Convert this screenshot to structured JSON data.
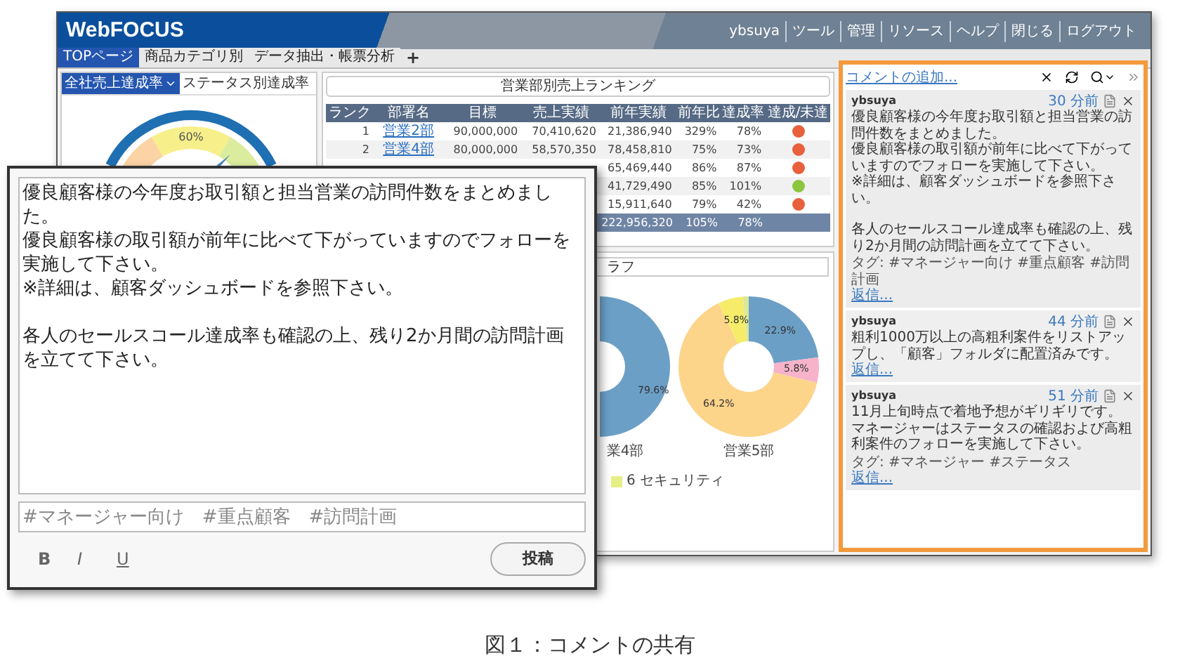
{
  "header": {
    "logo": "WebFOCUS",
    "links": [
      "ybsuya",
      "ツール",
      "管理",
      "リソース",
      "ヘルプ",
      "閉じる",
      "ログアウト"
    ]
  },
  "tabs": [
    {
      "label": "TOPページ",
      "selected": true
    },
    {
      "label": "商品カテゴリ別",
      "selected": false
    },
    {
      "label": "データ抽出・帳票分析",
      "selected": false
    }
  ],
  "add_tab": "+",
  "left_panel": {
    "tabs": [
      {
        "label": "全社売上達成率",
        "selected": true,
        "kind": "dropdown"
      },
      {
        "label": "ステータス別達成率",
        "selected": false,
        "kind": "plain"
      }
    ],
    "gauge_label": "60%"
  },
  "ranking": {
    "title": "営業部別売上ランキング",
    "columns": [
      "ランク",
      "部署名",
      "目標",
      "売上実績",
      "前年実績",
      "前年比",
      "達成率",
      "達成/未達"
    ],
    "rows": [
      {
        "rank": "1",
        "dept": "営業2部",
        "target": "90,000,000",
        "sales": "70,410,620",
        "prev": "21,386,940",
        "ratio": "329%",
        "rate": "78%",
        "color": "#e8603c"
      },
      {
        "rank": "2",
        "dept": "営業4部",
        "target": "80,000,000",
        "sales": "58,570,350",
        "prev": "78,458,810",
        "ratio": "75%",
        "rate": "73%",
        "color": "#e8603c"
      },
      {
        "prev": "65,469,440",
        "ratio": "86%",
        "rate": "87%",
        "color": "#e8603c"
      },
      {
        "prev": "41,729,490",
        "ratio": "85%",
        "rate": "101%",
        "color": "#8cc63f"
      },
      {
        "prev": "15,911,640",
        "ratio": "79%",
        "rate": "42%",
        "color": "#e8603c"
      }
    ],
    "total": {
      "prev": "222,956,320",
      "ratio": "105%",
      "rate": "78%"
    }
  },
  "graph": {
    "title": "ラフ",
    "left_donut": {
      "value_label": "79.6%",
      "caption": "業4部"
    },
    "chart_data": {
      "type": "donut",
      "title": "営業5部",
      "values": [
        22.9,
        5.8,
        64.2,
        5.8,
        1.3
      ],
      "colors": [
        "#6b9fc6",
        "#f6b3c9",
        "#fcd48a",
        "#f6ec6a",
        "#d9e89b"
      ],
      "value_labels": [
        "22.9%",
        "5.8%",
        "64.2%",
        "5.8%",
        null
      ]
    },
    "legend": [
      {
        "label": "6 セキュリティ",
        "color": "#e6ee86"
      }
    ]
  },
  "comments": {
    "add_link": "コメントの追加...",
    "items": [
      {
        "user": "ybsuya",
        "time": "30 分前",
        "blocks": [
          [
            "優良顧客様の今年度お取引額と担当営業の訪問件数をまとめました。",
            "優良顧客様の取引額が前年に比べて下がっていますのでフォローを実施して下さい。",
            "※詳細は、顧客ダッシュボードを参照下さい。"
          ],
          [
            "各人のセールスコール達成率も確認の上、残り2か月間の訪問計画を立てて下さい。"
          ]
        ],
        "tags": "タグ: #マネージャー向け #重点顧客 #訪問計画",
        "reply": "返信..."
      },
      {
        "user": "ybsuya",
        "time": "44 分前",
        "blocks": [
          [
            "粗利1000万以上の高粗利案件をリストアップし、「顧客」フォルダに配置済みです。"
          ]
        ],
        "reply": "返信..."
      },
      {
        "user": "ybsuya",
        "time": "51 分前",
        "blocks": [
          [
            "11月上旬時点で着地予想がギリギリです。",
            "マネージャーはステータスの確認および高粗利案件のフォローを実施して下さい。"
          ]
        ],
        "tags": "タグ: #マネージャー #ステータス",
        "reply": "返信..."
      }
    ]
  },
  "editor": {
    "blocks": [
      [
        "優良顧客様の今年度お取引額と担当営業の訪問件数をまとめました。",
        "優良顧客様の取引額が前年に比べて下がっていますのでフォローを実施して下さい。",
        "※詳細は、顧客ダッシュボードを参照下さい。"
      ],
      [
        "各人のセールスコール達成率も確認の上、残り2か月間の訪問計画を立てて下さい。"
      ]
    ],
    "tags": "#マネージャー向け　#重点顧客　#訪問計画",
    "format_buttons": [
      "B",
      "I",
      "U"
    ],
    "submit": "投稿"
  },
  "caption": "図１：コメントの共有"
}
